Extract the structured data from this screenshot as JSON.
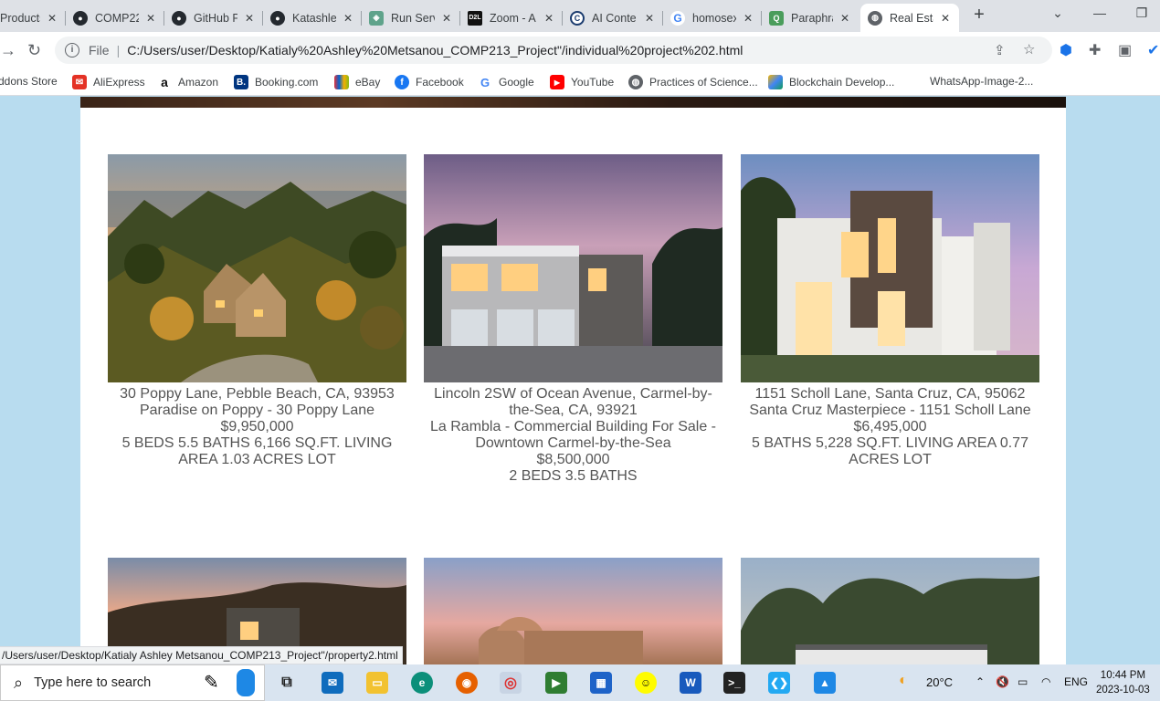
{
  "tabs": [
    {
      "label": "Products",
      "icon": "generic-tab-icon",
      "active": false
    },
    {
      "label": "COMP22",
      "icon": "github-icon",
      "active": false
    },
    {
      "label": "GitHub P",
      "icon": "github-icon",
      "active": false
    },
    {
      "label": "Katashle",
      "icon": "github-icon",
      "active": false
    },
    {
      "label": "Run Serv",
      "icon": "replit-icon",
      "active": false
    },
    {
      "label": "Zoom - A",
      "icon": "d2l-icon",
      "active": false
    },
    {
      "label": "AI Conte",
      "icon": "copyleaks-icon",
      "active": false
    },
    {
      "label": "homosex",
      "icon": "google-icon",
      "active": false
    },
    {
      "label": "Paraphra",
      "icon": "quillbot-icon",
      "active": false
    },
    {
      "label": "Real Esta",
      "icon": "globe-icon",
      "active": true
    }
  ],
  "address_bar": {
    "scheme_label": "File",
    "url": "C:/Users/user/Desktop/Katialy%20Ashley%20Metsanou_COMP213_Project\"/individual%20project%202.html"
  },
  "bookmarks": [
    {
      "label": "ddons Store",
      "icon": "none"
    },
    {
      "label": "AliExpress",
      "icon": "aliexpress-icon"
    },
    {
      "label": "Amazon",
      "icon": "amazon-icon"
    },
    {
      "label": "Booking.com",
      "icon": "booking-icon"
    },
    {
      "label": "eBay",
      "icon": "ebay-icon"
    },
    {
      "label": "Facebook",
      "icon": "facebook-icon"
    },
    {
      "label": "Google",
      "icon": "google-icon"
    },
    {
      "label": "YouTube",
      "icon": "youtube-icon"
    },
    {
      "label": "Practices of Science...",
      "icon": "globe-icon"
    },
    {
      "label": "Blockchain Develop...",
      "icon": "blockchain-icon"
    },
    {
      "label": "WhatsApp-Image-2...",
      "icon": "none"
    }
  ],
  "listings": [
    {
      "address": "30 Poppy Lane, Pebble Beach, CA, 93953",
      "title": "Paradise on Poppy - 30 Poppy Lane",
      "price": "$9,950,000",
      "details": "5 BEDS 5.5 BATHS 6,166 SQ.FT. LIVING AREA 1.03 ACRES LOT"
    },
    {
      "address": "Lincoln 2SW of Ocean Avenue, Carmel-by-the-Sea, CA, 93921",
      "title": "La Rambla - Commercial Building For Sale - Downtown Carmel-by-the-Sea",
      "price": "$8,500,000",
      "details": "2 BEDS 3.5 BATHS"
    },
    {
      "address": "1151 Scholl Lane, Santa Cruz, CA, 95062",
      "title": "Santa Cruz Masterpiece - 1151 Scholl Lane",
      "price": "$6,495,000",
      "details": "5 BATHS 5,228 SQ.FT. LIVING AREA 0.77 ACRES LOT"
    }
  ],
  "status_link": "/Users/user/Desktop/Katialy Ashley Metsanou_COMP213_Project\"/property2.html",
  "taskbar": {
    "search_placeholder": "Type here to search",
    "weather": "20°C",
    "language": "ENG",
    "time": "10:44 PM",
    "date": "2023-10-03"
  }
}
